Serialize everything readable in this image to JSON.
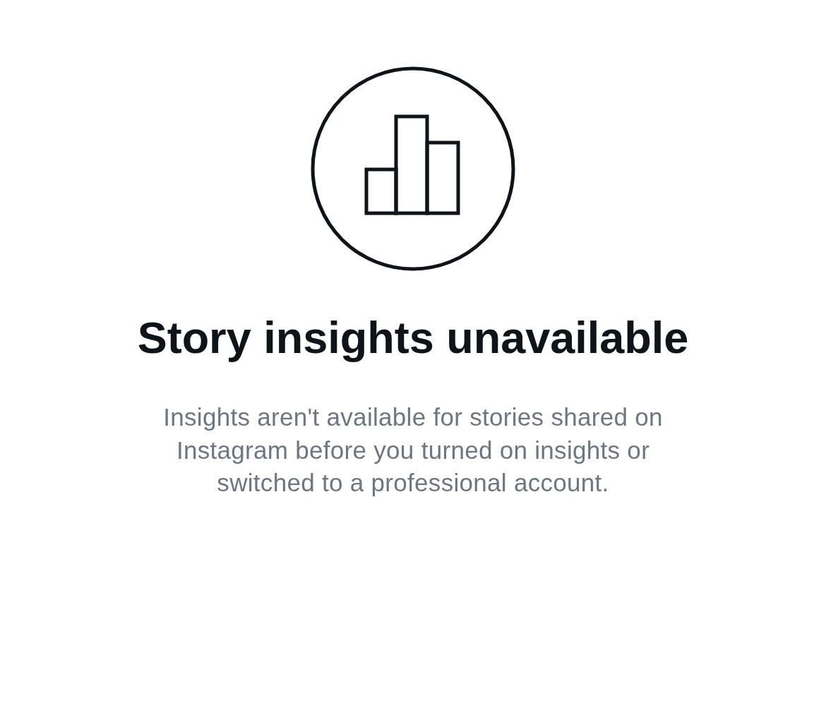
{
  "empty_state": {
    "title": "Story insights unavailable",
    "message": "Insights aren't available for stories shared on Instagram before you turned on insights or switched to a professional account."
  }
}
